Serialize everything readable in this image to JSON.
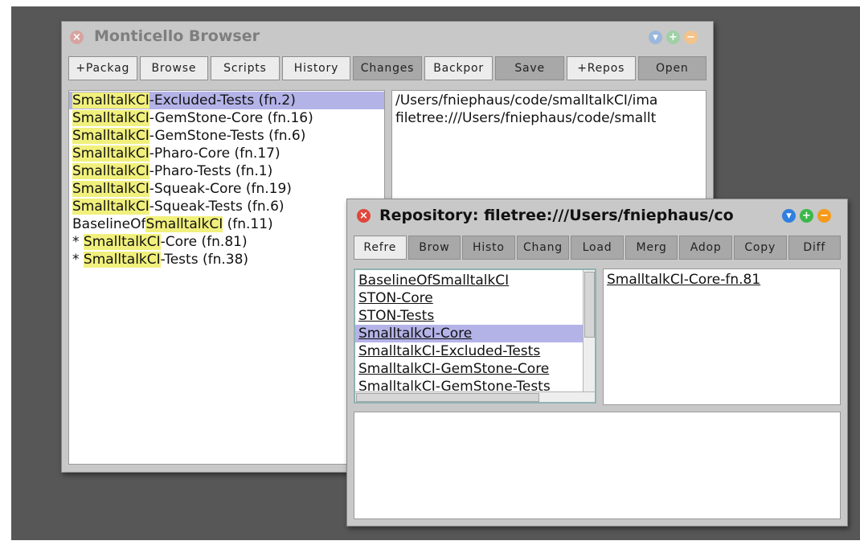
{
  "browser": {
    "title": "Monticello Browser",
    "buttons": [
      "+Packag",
      "Browse",
      "Scripts",
      "History",
      "Changes",
      "Backpor",
      "Save",
      "+Repos",
      "Open"
    ],
    "highlight": "SmalltalkCI",
    "packages": [
      {
        "prefix": "",
        "match": "SmalltalkCI",
        "suffix": "-Excluded-Tests (fn.2)"
      },
      {
        "prefix": "",
        "match": "SmalltalkCI",
        "suffix": "-GemStone-Core (fn.16)"
      },
      {
        "prefix": "",
        "match": "SmalltalkCI",
        "suffix": "-GemStone-Tests (fn.6)"
      },
      {
        "prefix": "",
        "match": "SmalltalkCI",
        "suffix": "-Pharo-Core (fn.17)"
      },
      {
        "prefix": "",
        "match": "SmalltalkCI",
        "suffix": "-Pharo-Tests (fn.1)"
      },
      {
        "prefix": "",
        "match": "SmalltalkCI",
        "suffix": "-Squeak-Core (fn.19)"
      },
      {
        "prefix": "",
        "match": "SmalltalkCI",
        "suffix": "-Squeak-Tests (fn.6)"
      },
      {
        "prefix": "BaselineOf",
        "match": "SmalltalkCI",
        "suffix": " (fn.11)"
      },
      {
        "prefix": "* ",
        "match": "SmalltalkCI",
        "suffix": "-Core (fn.81)"
      },
      {
        "prefix": "* ",
        "match": "SmalltalkCI",
        "suffix": "-Tests (fn.38)"
      }
    ],
    "repositories": [
      "/Users/fniephaus/code/smalltalkCI/ima",
      "filetree:///Users/fniephaus/code/smallt"
    ]
  },
  "repo": {
    "title": "Repository: filetree:///Users/fniephaus/co",
    "buttons": [
      "Refre",
      "Brow",
      "Histo",
      "Chang",
      "Load",
      "Merg",
      "Adop",
      "Copy",
      "Diff"
    ],
    "packages": [
      "BaselineOfSmalltalkCI",
      "STON-Core",
      "STON-Tests",
      "SmalltalkCI-Core",
      "SmalltalkCI-Excluded-Tests",
      "SmalltalkCI-GemStone-Core",
      "SmalltalkCI-GemStone-Tests"
    ],
    "versions": [
      "SmalltalkCI-Core-fn.81"
    ]
  },
  "colors": {
    "selection": "#b4b3e8",
    "highlight": "#f1f07d",
    "close_red": "#e0463a",
    "menu_blue": "#2f7fe0",
    "plus_green": "#3cb84a",
    "minus_orange": "#f59a1b"
  }
}
